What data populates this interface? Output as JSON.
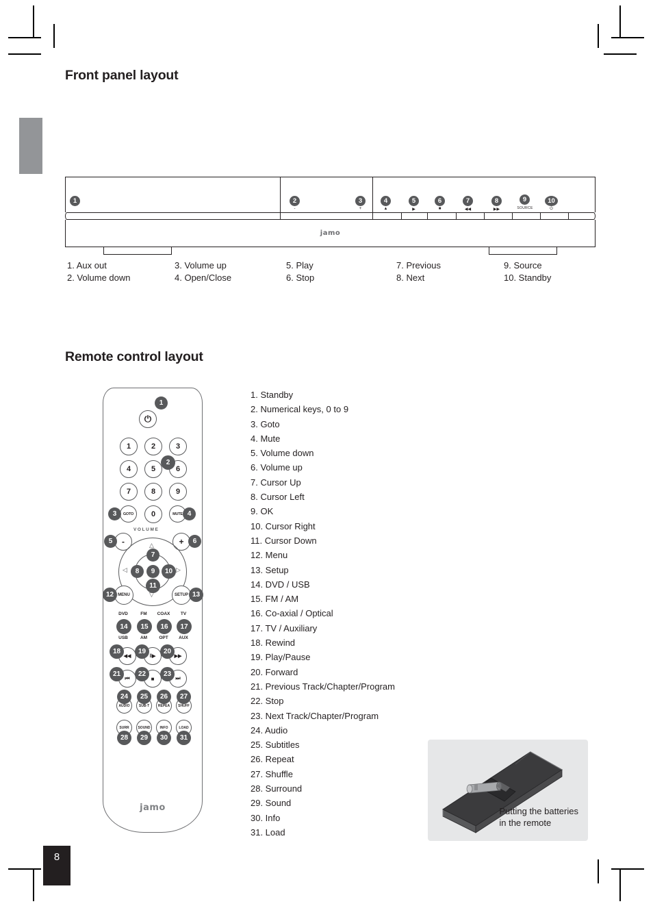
{
  "page": {
    "number": "8"
  },
  "front_panel": {
    "title": "Front panel layout",
    "logo": "jamo",
    "callouts": [
      {
        "n": "1",
        "glyph": ""
      },
      {
        "n": "2",
        "glyph": "-"
      },
      {
        "n": "3",
        "glyph": "+"
      },
      {
        "n": "4",
        "glyph": "▲"
      },
      {
        "n": "5",
        "glyph": "▶"
      },
      {
        "n": "6",
        "glyph": "■"
      },
      {
        "n": "7",
        "glyph": "◀◀"
      },
      {
        "n": "8",
        "glyph": "▶▶"
      },
      {
        "n": "9",
        "glyph": "SOURCE"
      },
      {
        "n": "10",
        "glyph": "⏻"
      }
    ],
    "legend_columns": [
      [
        "1. Aux out",
        "2. Volume down"
      ],
      [
        "3. Volume up",
        "4. Open/Close"
      ],
      [
        "5. Play",
        "6. Stop"
      ],
      [
        "7. Previous",
        "8. Next"
      ],
      [
        "9. Source",
        "10. Standby"
      ]
    ]
  },
  "remote": {
    "title": "Remote control layout",
    "logo": "jamo",
    "volume_label": "VOLUME",
    "legend": [
      "1. Standby",
      "2. Numerical keys, 0 to 9",
      "3. Goto",
      "4. Mute",
      "5. Volume down",
      "6. Volume up",
      "7. Cursor Up",
      "8. Cursor Left",
      "9. OK",
      "10. Cursor Right",
      "11. Cursor Down",
      "12. Menu",
      "13. Setup",
      "14. DVD / USB",
      "15. FM / AM",
      "16. Co-axial / Optical",
      "17. TV / Auxiliary",
      "18. Rewind",
      "19. Play/Pause",
      "20. Forward",
      "21. Previous Track/Chapter/Program",
      "22. Stop",
      "23. Next Track/Chapter/Program",
      "24. Audio",
      "25. Subtitles",
      "26. Repeat",
      "27. Shuffle",
      "28. Surround",
      "29. Sound",
      "30. Info",
      "31. Load"
    ],
    "keys": {
      "power": "⏻",
      "num1": "1",
      "num2": "2",
      "num3": "3",
      "num4": "4",
      "num5": "5",
      "num6": "6",
      "num7": "7",
      "num8": "8",
      "num9": "9",
      "num0": "0",
      "goto": "GOTO",
      "mute": "MUTE",
      "vol_down": "-",
      "vol_up": "+",
      "menu": "MENU",
      "setup": "SETUP",
      "arrow_up": "△",
      "arrow_down": "▽",
      "arrow_left": "◁",
      "arrow_right": "▷",
      "src_dvd_top": "DVD",
      "src_dvd_bottom": "USB",
      "src_fm_top": "FM",
      "src_fm_bottom": "AM",
      "src_coax_top": "COAX",
      "src_coax_bottom": "OPT",
      "src_tv_top": "TV",
      "src_tv_bottom": "AUX",
      "rewind": "◀◀",
      "play_pause": "‖▶",
      "forward": "▶▶",
      "prev_track": "⏮",
      "stop": "■",
      "next_track": "⏭",
      "audio": "AUDIO",
      "subtitle": "SUB-T",
      "repeat": "REPEA",
      "shuffle": "SHUFF",
      "surround": "SURR",
      "sound": "SOUND",
      "info": "INFO",
      "load": "LOAD"
    },
    "callout_numbers": {
      "c1": "1",
      "c2": "2",
      "c3": "3",
      "c4": "4",
      "c5": "5",
      "c6": "6",
      "c7": "7",
      "c8": "8",
      "c9": "9",
      "c10": "10",
      "c11": "11",
      "c12": "12",
      "c13": "13",
      "c14": "14",
      "c15": "15",
      "c16": "16",
      "c17": "17",
      "c18": "18",
      "c19": "19",
      "c20": "20",
      "c21": "21",
      "c22": "22",
      "c23": "23",
      "c24": "24",
      "c25": "25",
      "c26": "26",
      "c27": "27",
      "c28": "28",
      "c29": "29",
      "c30": "30",
      "c31": "31"
    }
  },
  "battery_note": {
    "line1": "Putting the batteries",
    "line2": "in the remote"
  }
}
